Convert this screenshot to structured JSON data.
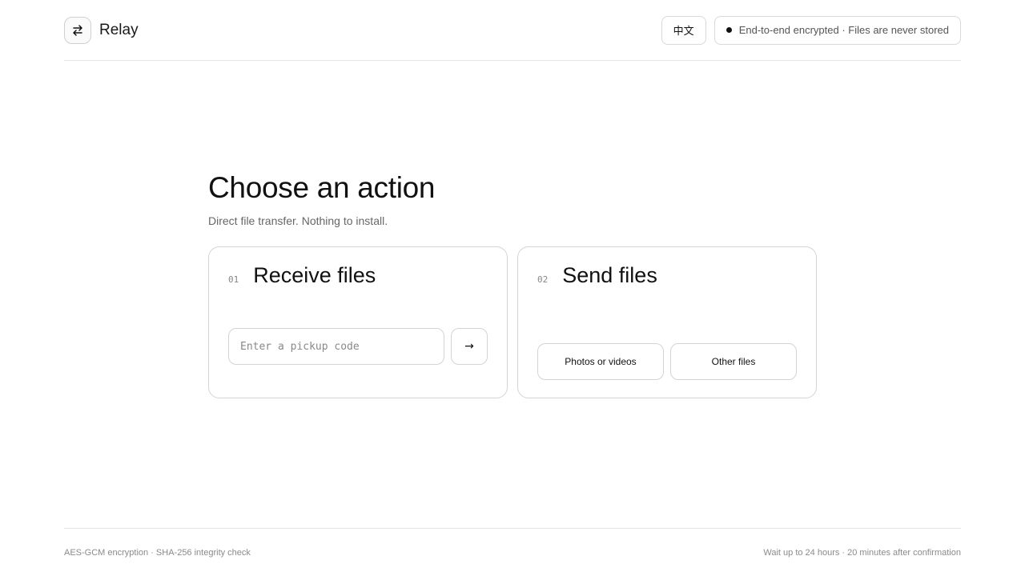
{
  "header": {
    "brand_name": "Relay",
    "logo_icon": "swap-arrows-icon",
    "language_button": "中文",
    "status_text": "End-to-end encrypted · Files are never stored"
  },
  "main": {
    "title": "Choose an action",
    "subtitle": "Direct file transfer. Nothing to install."
  },
  "receive_card": {
    "number": "01",
    "title": "Receive files",
    "input_placeholder": "Enter a pickup code",
    "submit_icon": "→"
  },
  "send_card": {
    "number": "02",
    "title": "Send files",
    "photos_button": "Photos or videos",
    "other_button": "Other files"
  },
  "footer": {
    "left_text": "AES-GCM encryption · SHA-256 integrity check",
    "right_text": "Wait up to 24 hours · 20 minutes after confirmation"
  }
}
